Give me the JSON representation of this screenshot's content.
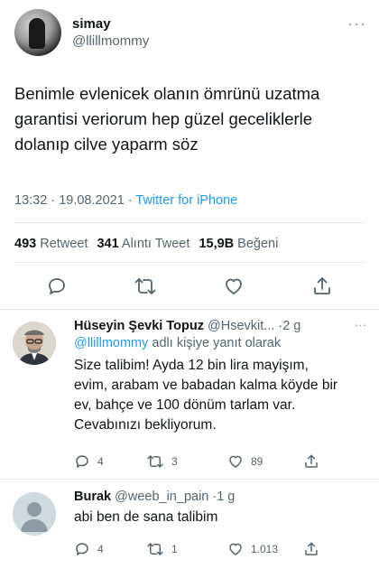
{
  "tweet": {
    "display_name": "simay",
    "handle": "@llillmommy",
    "text": "Benimle evlenicek olanın ömrünü uzatma garantisi veriorum hep güzel geceliklerle dolanıp cilve yaparm söz",
    "time": "13:32",
    "date": "19.08.2021",
    "source": "Twitter for iPhone",
    "stats": {
      "retweets_count": "493",
      "retweets_label": "Retweet",
      "quotes_count": "341",
      "quotes_label": "Alıntı Tweet",
      "likes_count": "15,9B",
      "likes_label": "Beğeni"
    },
    "icons": [
      "reply-icon",
      "retweet-icon",
      "like-icon",
      "share-icon"
    ]
  },
  "replies": [
    {
      "display_name": "Hüseyin Şevki Topuz",
      "handle": "@Hsevkit...",
      "age": "2 g",
      "reply_to_mention": "@llillmommy",
      "reply_to_suffix": "adlı kişiye yanıt olarak",
      "text": "Size talibim! Ayda 12 bin lira mayişım, evim, arabam ve babadan kalma köyde bir ev, bahçe ve 100 dönüm tarlam var. Cevabınızı bekliyorum.",
      "reply_count": "4",
      "retweet_count": "3",
      "like_count": "89"
    },
    {
      "display_name": "Burak",
      "handle": "@weeb_in_pain",
      "age": "1 g",
      "text": "abi ben de sana talibim",
      "reply_count": "4",
      "retweet_count": "1",
      "like_count": "1.013"
    }
  ],
  "colors": {
    "text": "#0f1419",
    "muted": "#536471",
    "link": "#1d9bf0",
    "divider": "#e6ecf0"
  }
}
